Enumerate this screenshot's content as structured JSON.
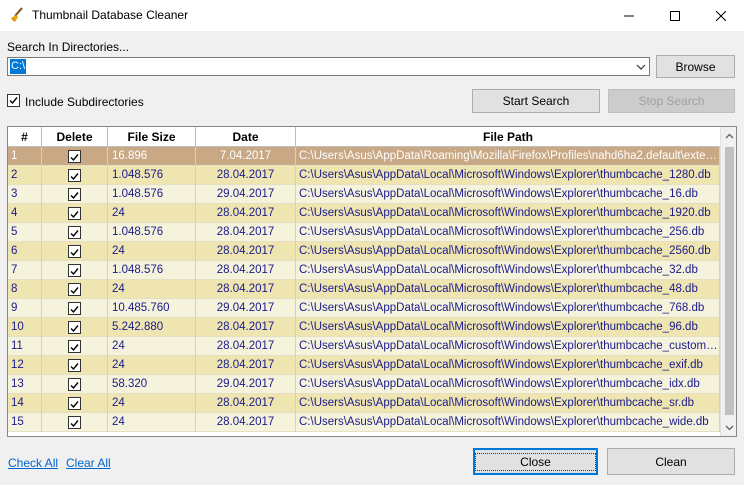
{
  "window": {
    "title": "Thumbnail Database Cleaner"
  },
  "search": {
    "label": "Search In Directories...",
    "directory": "C:\\",
    "browse_label": "Browse",
    "include_subdirectories_label": "Include Subdirectories",
    "include_subdirectories": true,
    "start_label": "Start Search",
    "stop_label": "Stop Search"
  },
  "table": {
    "columns": [
      "#",
      "Delete",
      "File Size",
      "Date",
      "File Path"
    ],
    "rows": [
      {
        "num": "1",
        "delete": true,
        "size": "16.896",
        "date": "7.04.2017",
        "path": "C:\\Users\\Asus\\AppData\\Roaming\\Mozilla\\Firefox\\Profiles\\nahd6ha2.default\\extensi..."
      },
      {
        "num": "2",
        "delete": true,
        "size": "1.048.576",
        "date": "28.04.2017",
        "path": "C:\\Users\\Asus\\AppData\\Local\\Microsoft\\Windows\\Explorer\\thumbcache_1280.db"
      },
      {
        "num": "3",
        "delete": true,
        "size": "1.048.576",
        "date": "29.04.2017",
        "path": "C:\\Users\\Asus\\AppData\\Local\\Microsoft\\Windows\\Explorer\\thumbcache_16.db"
      },
      {
        "num": "4",
        "delete": true,
        "size": "24",
        "date": "28.04.2017",
        "path": "C:\\Users\\Asus\\AppData\\Local\\Microsoft\\Windows\\Explorer\\thumbcache_1920.db"
      },
      {
        "num": "5",
        "delete": true,
        "size": "1.048.576",
        "date": "28.04.2017",
        "path": "C:\\Users\\Asus\\AppData\\Local\\Microsoft\\Windows\\Explorer\\thumbcache_256.db"
      },
      {
        "num": "6",
        "delete": true,
        "size": "24",
        "date": "28.04.2017",
        "path": "C:\\Users\\Asus\\AppData\\Local\\Microsoft\\Windows\\Explorer\\thumbcache_2560.db"
      },
      {
        "num": "7",
        "delete": true,
        "size": "1.048.576",
        "date": "28.04.2017",
        "path": "C:\\Users\\Asus\\AppData\\Local\\Microsoft\\Windows\\Explorer\\thumbcache_32.db"
      },
      {
        "num": "8",
        "delete": true,
        "size": "24",
        "date": "28.04.2017",
        "path": "C:\\Users\\Asus\\AppData\\Local\\Microsoft\\Windows\\Explorer\\thumbcache_48.db"
      },
      {
        "num": "9",
        "delete": true,
        "size": "10.485.760",
        "date": "29.04.2017",
        "path": "C:\\Users\\Asus\\AppData\\Local\\Microsoft\\Windows\\Explorer\\thumbcache_768.db"
      },
      {
        "num": "10",
        "delete": true,
        "size": "5.242.880",
        "date": "28.04.2017",
        "path": "C:\\Users\\Asus\\AppData\\Local\\Microsoft\\Windows\\Explorer\\thumbcache_96.db"
      },
      {
        "num": "11",
        "delete": true,
        "size": "24",
        "date": "28.04.2017",
        "path": "C:\\Users\\Asus\\AppData\\Local\\Microsoft\\Windows\\Explorer\\thumbcache_custom_st..."
      },
      {
        "num": "12",
        "delete": true,
        "size": "24",
        "date": "28.04.2017",
        "path": "C:\\Users\\Asus\\AppData\\Local\\Microsoft\\Windows\\Explorer\\thumbcache_exif.db"
      },
      {
        "num": "13",
        "delete": true,
        "size": "58.320",
        "date": "29.04.2017",
        "path": "C:\\Users\\Asus\\AppData\\Local\\Microsoft\\Windows\\Explorer\\thumbcache_idx.db"
      },
      {
        "num": "14",
        "delete": true,
        "size": "24",
        "date": "28.04.2017",
        "path": "C:\\Users\\Asus\\AppData\\Local\\Microsoft\\Windows\\Explorer\\thumbcache_sr.db"
      },
      {
        "num": "15",
        "delete": true,
        "size": "24",
        "date": "28.04.2017",
        "path": "C:\\Users\\Asus\\AppData\\Local\\Microsoft\\Windows\\Explorer\\thumbcache_wide.db"
      }
    ]
  },
  "footer": {
    "check_all_label": "Check All",
    "clear_all_label": "Clear All",
    "close_label": "Close",
    "clean_label": "Clean"
  },
  "icons": {
    "app": "broom-icon",
    "minimize": "minimize-icon",
    "maximize": "maximize-icon",
    "close": "close-icon",
    "dropdown": "chevron-down-icon",
    "checkbox": "checkmark-icon"
  },
  "colors": {
    "selected_row": "#c9a886",
    "row_odd": "#f5f3dc",
    "row_even": "#eee5b1",
    "accent": "#0078d7",
    "link": "#0066cc"
  }
}
